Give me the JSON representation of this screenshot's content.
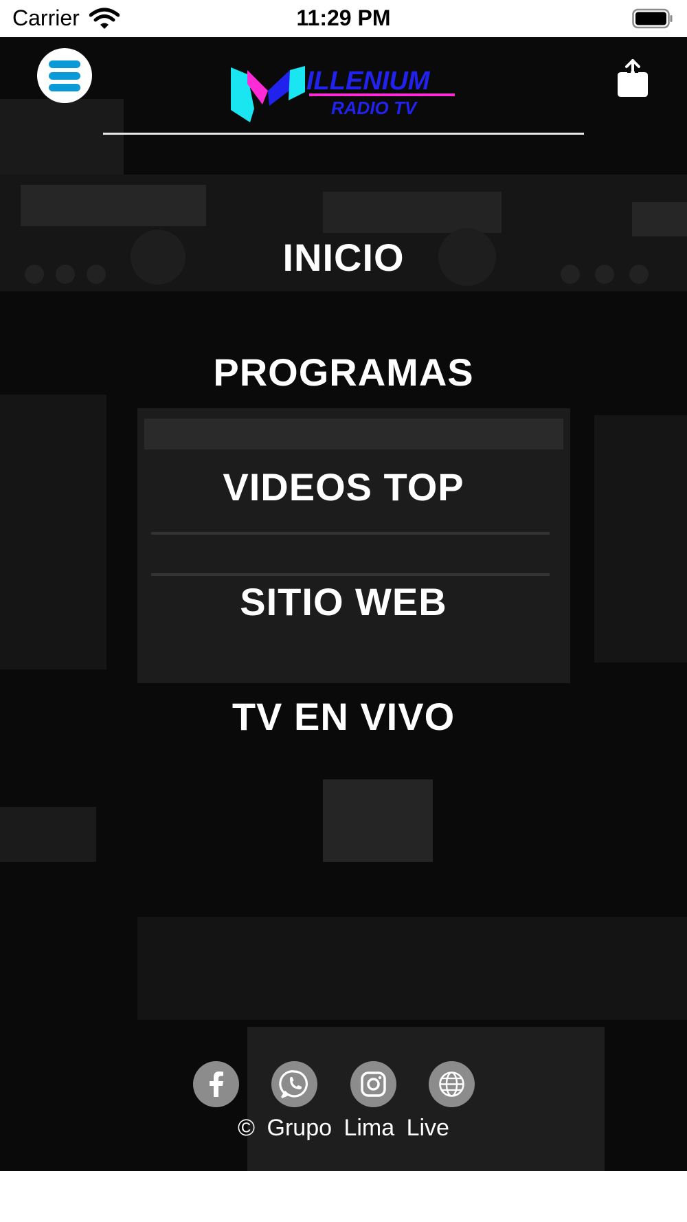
{
  "status_bar": {
    "carrier": "Carrier",
    "time": "11:29 PM"
  },
  "header": {
    "logo_text_main": "ILLENIUM",
    "logo_text_sub": "RADIO TV",
    "colors": {
      "accent": "#0a9ad8",
      "logo_cyan": "#19e6f0",
      "logo_magenta": "#ff2bd6",
      "logo_blue": "#2222ee"
    }
  },
  "nav": {
    "items": [
      {
        "label": "INICIO"
      },
      {
        "label": "PROGRAMAS"
      },
      {
        "label": "VIDEOS TOP"
      },
      {
        "label": "SITIO WEB"
      },
      {
        "label": "TV EN VIVO"
      }
    ]
  },
  "footer": {
    "social": [
      "facebook-icon",
      "whatsapp-icon",
      "instagram-icon",
      "globe-icon"
    ],
    "copyright": "© Grupo Lima Live"
  }
}
